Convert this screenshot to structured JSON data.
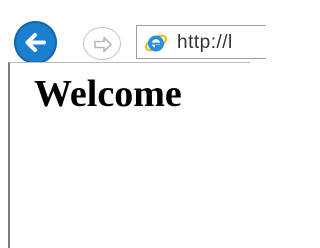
{
  "browser": {
    "back_button": {
      "icon": "back-arrow-icon",
      "color": "#1b7fd0"
    },
    "forward_button": {
      "icon": "forward-arrow-icon"
    },
    "address_bar": {
      "icon": "internet-explorer-icon",
      "url": "http://l"
    }
  },
  "page": {
    "heading": "Welcome"
  }
}
